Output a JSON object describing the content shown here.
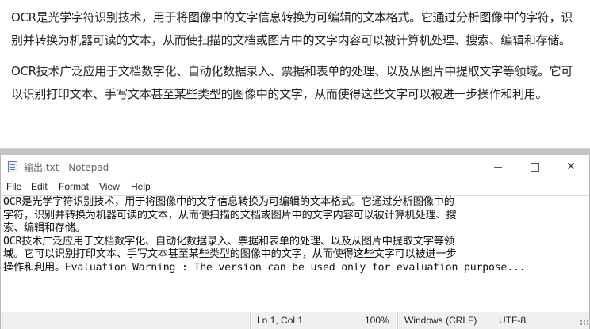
{
  "document": {
    "paragraphs": [
      "OCR是光学字符识别技术，用于将图像中的文字信息转换为可编辑的文本格式。它通过分析图像中的字符，识别并转换为机器可读的文本，从而使扫描的文档或图片中的文字内容可以被计算机处理、搜索、编辑和存储。",
      "OCR技术广泛应用于文档数字化、自动化数据录入、票据和表单的处理、以及从图片中提取文字等领域。它可以识别打印文本、手写文本甚至某些类型的图像中的文字，从而使得这些文字可以被进一步操作和利用。"
    ]
  },
  "notepad": {
    "title": "输出.txt - Notepad",
    "window_buttons": {
      "minimize": "",
      "maximize": "",
      "close": "✕"
    },
    "menu": [
      "File",
      "Edit",
      "Format",
      "View",
      "Help"
    ],
    "lines": [
      "OCR是光学字符识别技术，用于将图像中的文字信息转换为可编辑的文本格式。它通过分析图像中的",
      "字符，识别并转换为机器可读的文本，从而使扫描的文档或图片中的文字内容可以被计算机处理、搜",
      "索、编辑和存储。",
      "OCR技术广泛应用于文档数字化、自动化数据录入、票据和表单的处理、以及从图片中提取文字等领",
      "域。它可以识别打印文本、手写文本甚至某些类型的图像中的文字，从而使得这些文字可以被进一步",
      "操作和利用。Evaluation Warning : The version can be used only for evaluation purpose..."
    ],
    "status": {
      "position": "Ln 1, Col 1",
      "zoom": "100%",
      "line_ending": "Windows (CRLF)",
      "encoding": "UTF-8"
    }
  }
}
